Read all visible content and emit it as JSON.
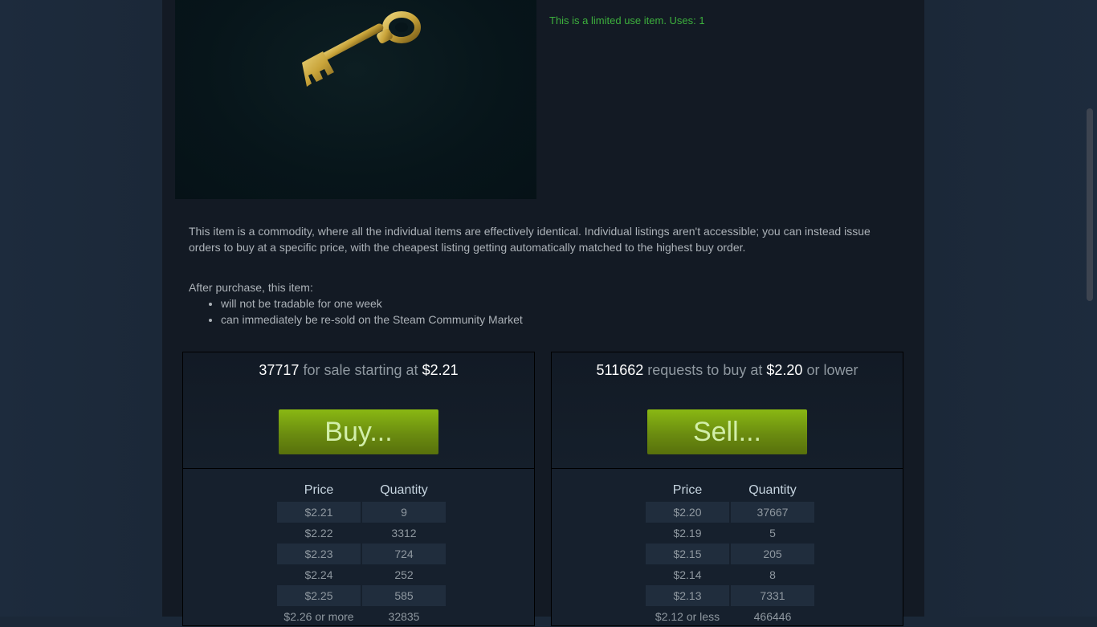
{
  "item": {
    "limited_use": "This is a limited use item. Uses: 1"
  },
  "description": {
    "commodity": "This item is a commodity, where all the individual items are effectively identical. Individual listings aren't accessible; you can instead issue orders to buy at a specific price, with the cheapest listing getting automatically matched to the highest buy order.",
    "after_purchase": "After purchase, this item:",
    "bullets": [
      "will not be tradable for one week",
      "can immediately be re-sold on the Steam Community Market"
    ]
  },
  "buy_box": {
    "count": "37717",
    "summary_text": "for sale starting at",
    "price": "$2.21",
    "button": "Buy...",
    "col_price": "Price",
    "col_quantity": "Quantity",
    "rows": [
      {
        "price": "$2.21",
        "qty": "9"
      },
      {
        "price": "$2.22",
        "qty": "3312"
      },
      {
        "price": "$2.23",
        "qty": "724"
      },
      {
        "price": "$2.24",
        "qty": "252"
      },
      {
        "price": "$2.25",
        "qty": "585"
      },
      {
        "price": "$2.26 or more",
        "qty": "32835"
      }
    ]
  },
  "sell_box": {
    "count": "511662",
    "summary_text": "requests to buy at",
    "price": "$2.20",
    "suffix": "or lower",
    "button": "Sell...",
    "col_price": "Price",
    "col_quantity": "Quantity",
    "rows": [
      {
        "price": "$2.20",
        "qty": "37667"
      },
      {
        "price": "$2.19",
        "qty": "5"
      },
      {
        "price": "$2.15",
        "qty": "205"
      },
      {
        "price": "$2.14",
        "qty": "8"
      },
      {
        "price": "$2.13",
        "qty": "7331"
      },
      {
        "price": "$2.12 or less",
        "qty": "466446"
      }
    ]
  }
}
